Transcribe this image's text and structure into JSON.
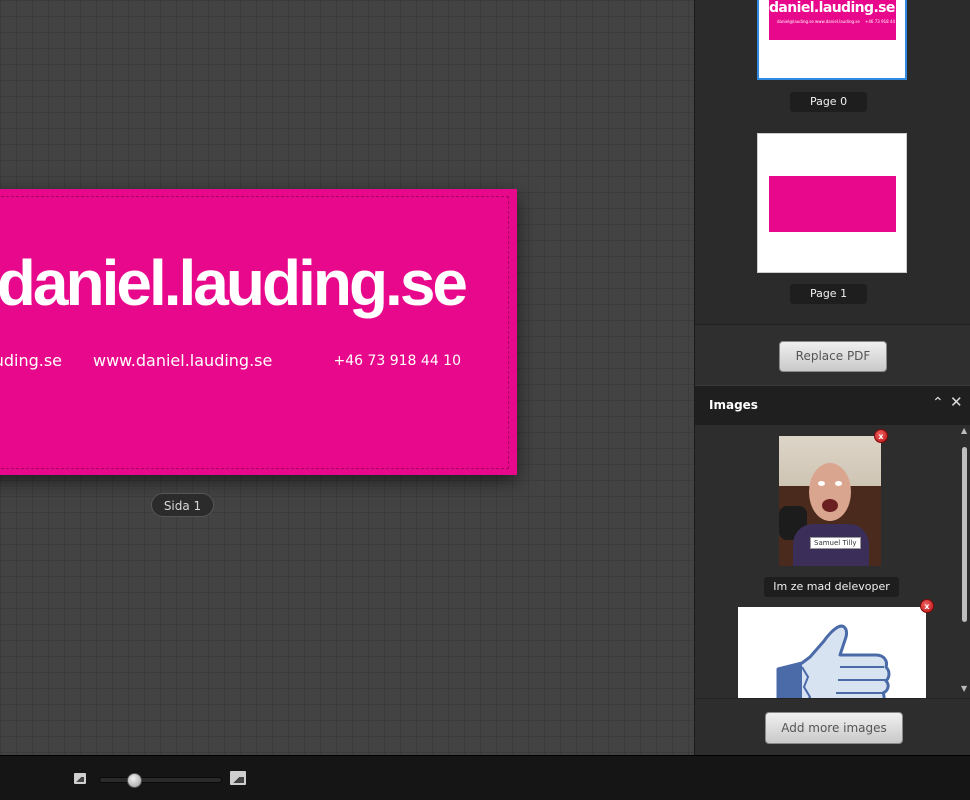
{
  "card": {
    "domain": "daniel.lauding.se",
    "email": "daniel@lauding.se",
    "website": "www.daniel.lauding.se",
    "phone": "+46 73 918 44 10",
    "color": "#e8088c",
    "page_label": "Sida 1"
  },
  "zoom": {
    "level_fraction": 0.28
  },
  "pages": {
    "items": [
      {
        "label": "Page 0",
        "selected": true
      },
      {
        "label": "Page 1",
        "selected": false
      }
    ],
    "replace_label": "Replace PDF"
  },
  "images": {
    "title": "Images",
    "items": [
      {
        "caption": "Im ze mad delevoper",
        "photo_tag": "Samuel Tilly"
      },
      {
        "caption": ""
      }
    ],
    "add_label": "Add more images"
  },
  "colors": {
    "accent": "#e8088c",
    "selection": "#2f8ae0",
    "remove": "#d11f1f"
  }
}
